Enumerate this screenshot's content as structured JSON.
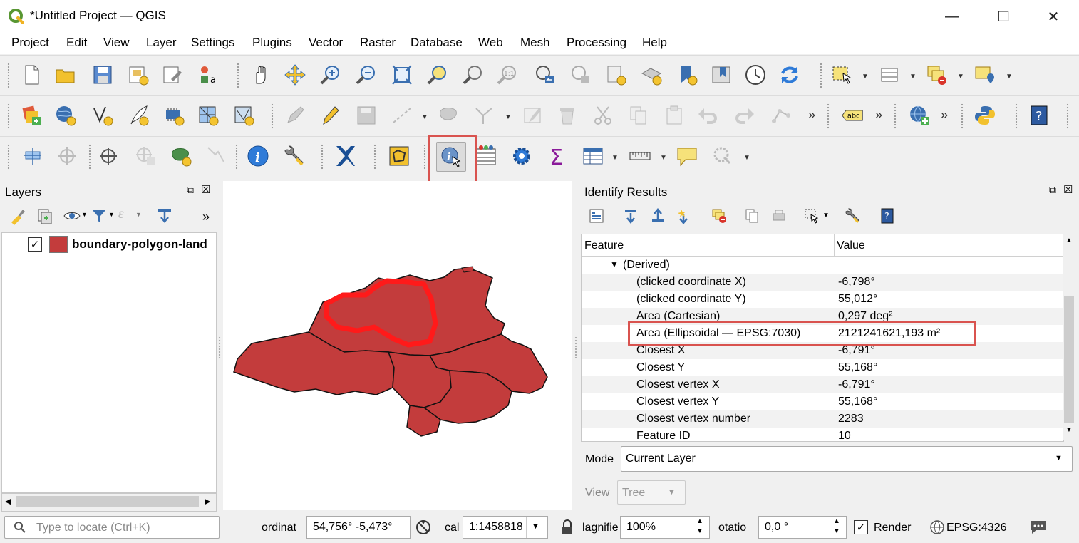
{
  "window": {
    "title": "*Untitled Project — QGIS",
    "minimize": "—",
    "maximize": "☐",
    "close": "✕"
  },
  "menu": [
    "Project",
    "Edit",
    "View",
    "Layer",
    "Settings",
    "Plugins",
    "Vector",
    "Raster",
    "Database",
    "Web",
    "Mesh",
    "Processing",
    "Help"
  ],
  "toolbar": {
    "more": "»",
    "label_tool_text": "abc"
  },
  "layers_panel": {
    "title": "Layers",
    "more": "»",
    "layers": [
      {
        "name": "boundary-polygon-land",
        "checked": true,
        "color": "#c33c3c"
      }
    ]
  },
  "identify_panel": {
    "title": "Identify Results",
    "columns": [
      "Feature",
      "Value"
    ],
    "group": "(Derived)",
    "rows": [
      {
        "feature": "(clicked coordinate X)",
        "value": "-6,798°"
      },
      {
        "feature": "(clicked coordinate Y)",
        "value": "55,012°"
      },
      {
        "feature": "Area (Cartesian)",
        "value": "0,297 deg²"
      },
      {
        "feature": "Area (Ellipsoidal — EPSG:7030)",
        "value": "2121241621,193 m²"
      },
      {
        "feature": "Closest X",
        "value": "-6,791°"
      },
      {
        "feature": "Closest Y",
        "value": "55,168°"
      },
      {
        "feature": "Closest vertex X",
        "value": "-6,791°"
      },
      {
        "feature": "Closest vertex Y",
        "value": "55,168°"
      },
      {
        "feature": "Closest vertex number",
        "value": "2283"
      },
      {
        "feature": "Feature ID",
        "value": "10"
      }
    ],
    "mode_label": "Mode",
    "mode_value": "Current Layer",
    "view_label": "View",
    "view_value": "Tree"
  },
  "statusbar": {
    "locate_placeholder": "Type to locate (Ctrl+K)",
    "coordinate_label": "ordinat",
    "coordinate_value": "54,756°  -5,473°",
    "scale_label": "cal",
    "scale_value": "1:1458818",
    "magnifier_label": "lagnifie",
    "magnifier_value": "100%",
    "rotation_label": "otatio",
    "rotation_value": "0,0 °",
    "render_label": "Render",
    "render_checked": true,
    "crs": "EPSG:4326"
  },
  "colors": {
    "highlight": "#d9534f",
    "polygon_fill": "#c33c3c",
    "selected_outline": "#ff1a1a",
    "qgis_green": "#589632"
  }
}
